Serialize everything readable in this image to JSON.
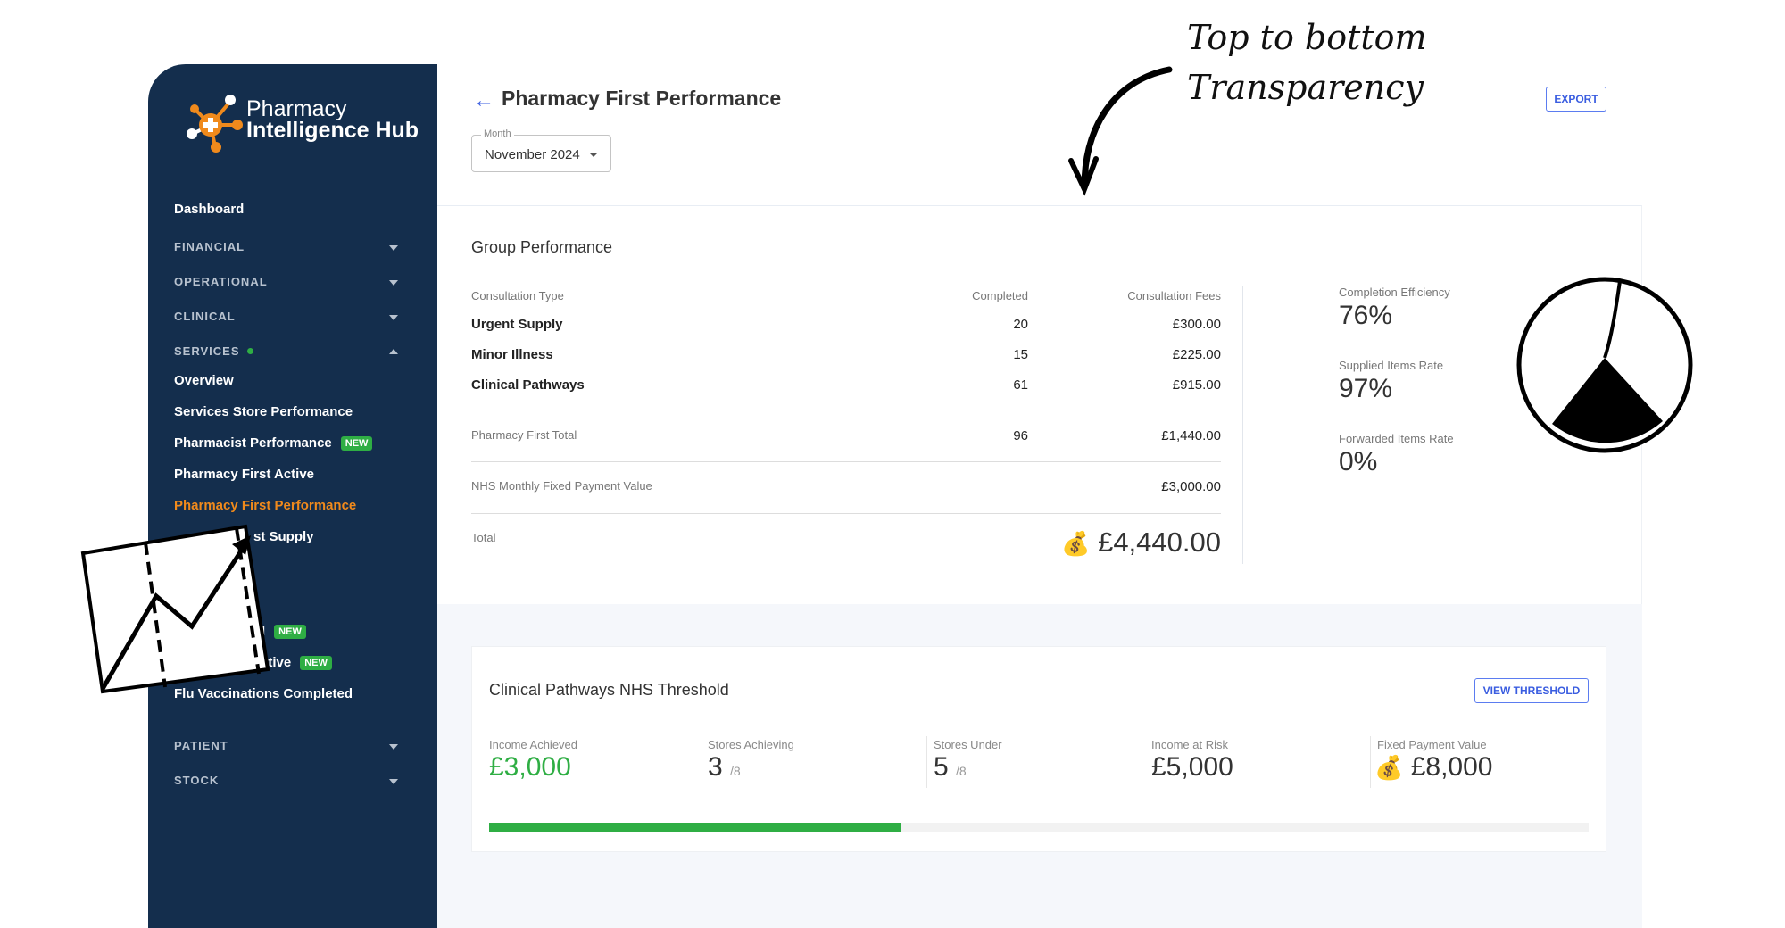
{
  "brand": {
    "line1": "Pharmacy",
    "line2": "Intelligence Hub",
    "accent": "#f08a1c",
    "sidebar_bg": "#142e4d"
  },
  "sidebar": {
    "dashboard": "Dashboard",
    "sections": {
      "financial": "FINANCIAL",
      "operational": "OPERATIONAL",
      "clinical": "CLINICAL",
      "services": "SERVICES",
      "patient": "PATIENT",
      "stock": "STOCK"
    },
    "services_items": [
      {
        "label": "Overview"
      },
      {
        "label": "Services Store Performance"
      },
      {
        "label": "Pharmacist Performance",
        "badge": "NEW"
      },
      {
        "label": "Pharmacy First Active"
      },
      {
        "label": "Pharmacy First Performance",
        "active": true
      },
      {
        "label": "st Supply"
      },
      {
        "label": "d",
        "badge": "NEW"
      },
      {
        "label": "ctive",
        "badge": "NEW"
      },
      {
        "label": "Flu Vaccinations Completed"
      }
    ]
  },
  "header": {
    "title": "Pharmacy First Performance",
    "export": "EXPORT",
    "month_label": "Month",
    "month_value": "November 2024"
  },
  "annotation": {
    "line1": "Top to bottom",
    "line2": "Transparency"
  },
  "group": {
    "title": "Group Performance",
    "columns": [
      "Consultation Type",
      "Completed",
      "Consultation Fees"
    ],
    "rows": [
      {
        "type": "Urgent Supply",
        "completed": "20",
        "fees": "£300.00"
      },
      {
        "type": "Minor Illness",
        "completed": "15",
        "fees": "£225.00"
      },
      {
        "type": "Clinical Pathways",
        "completed": "61",
        "fees": "£915.00"
      }
    ],
    "pf_total_label": "Pharmacy First Total",
    "pf_total_completed": "96",
    "pf_total_fees": "£1,440.00",
    "nhs_label": "NHS Monthly Fixed Payment Value",
    "nhs_value": "£3,000.00",
    "total_label": "Total",
    "total_value": "£4,440.00"
  },
  "kpis": [
    {
      "label": "Completion Efficiency",
      "value": "76%"
    },
    {
      "label": "Supplied Items Rate",
      "value": "97%"
    },
    {
      "label": "Forwarded Items Rate",
      "value": "0%"
    }
  ],
  "threshold": {
    "title": "Clinical Pathways NHS Threshold",
    "button": "VIEW THRESHOLD",
    "income_achieved_label": "Income Achieved",
    "income_achieved": "£3,000",
    "stores_achieving_label": "Stores Achieving",
    "stores_achieving": "3",
    "stores_achieving_of": "/8",
    "stores_under_label": "Stores Under",
    "stores_under": "5",
    "stores_under_of": "/8",
    "income_risk_label": "Income at Risk",
    "income_risk": "£5,000",
    "fixed_label": "Fixed Payment Value",
    "fixed_value": "£8,000",
    "progress_percent": 37.5,
    "progress_color": "#2fae44"
  }
}
